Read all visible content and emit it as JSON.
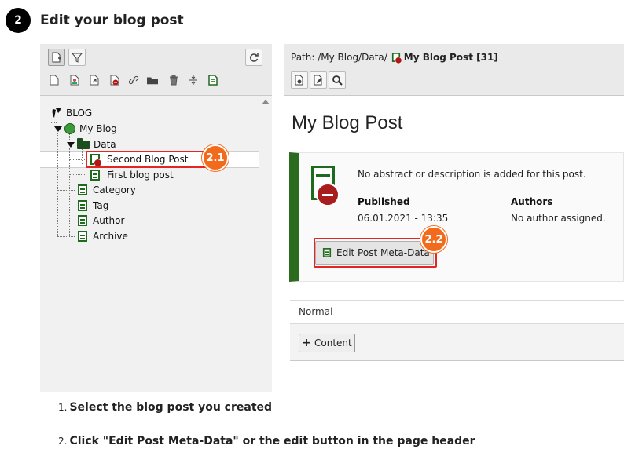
{
  "step": {
    "number": "2",
    "title": "Edit your blog post"
  },
  "tree_toolbar": {
    "buttons": [
      "new-page-icon",
      "filter-icon"
    ],
    "refresh_icon": "refresh-icon",
    "doctypes": [
      "page-icon",
      "user-page-icon",
      "link-page-icon",
      "blog-post-icon",
      "shortcut-icon",
      "folder-icon",
      "trash-icon",
      "separator-icon",
      "backend-section-icon"
    ]
  },
  "tree": {
    "root": "BLOG",
    "site": "My Blog",
    "folder": "Data",
    "selected": "Second Blog Post",
    "items": [
      "First blog post",
      "Category",
      "Tag",
      "Author",
      "Archive"
    ]
  },
  "doc_header": {
    "path_prefix": "Path: /My Blog/Data/",
    "path_current": "My Blog Post [31]",
    "buttons": [
      "view-icon",
      "edit-page-icon",
      "search-icon"
    ]
  },
  "main": {
    "page_title": "My Blog Post",
    "abstract": "No abstract or description is added for this post.",
    "published_label": "Published",
    "published_value": "06.01.2021 - 13:35",
    "authors_label": "Authors",
    "authors_value": "No author assigned.",
    "edit_meta_label": "Edit Post Meta-Data",
    "column_label": "Normal",
    "content_button": "Content"
  },
  "annotations": {
    "badge_1": "2.1",
    "badge_2": "2.2",
    "highlight_color": "#e52521",
    "badge_color": "#f26b1d"
  },
  "instructions": [
    {
      "num": "1.",
      "text": "Select the blog post you created"
    },
    {
      "num": "2.",
      "text": "Click \"Edit Post Meta-Data\" or the edit button in the page header"
    }
  ]
}
